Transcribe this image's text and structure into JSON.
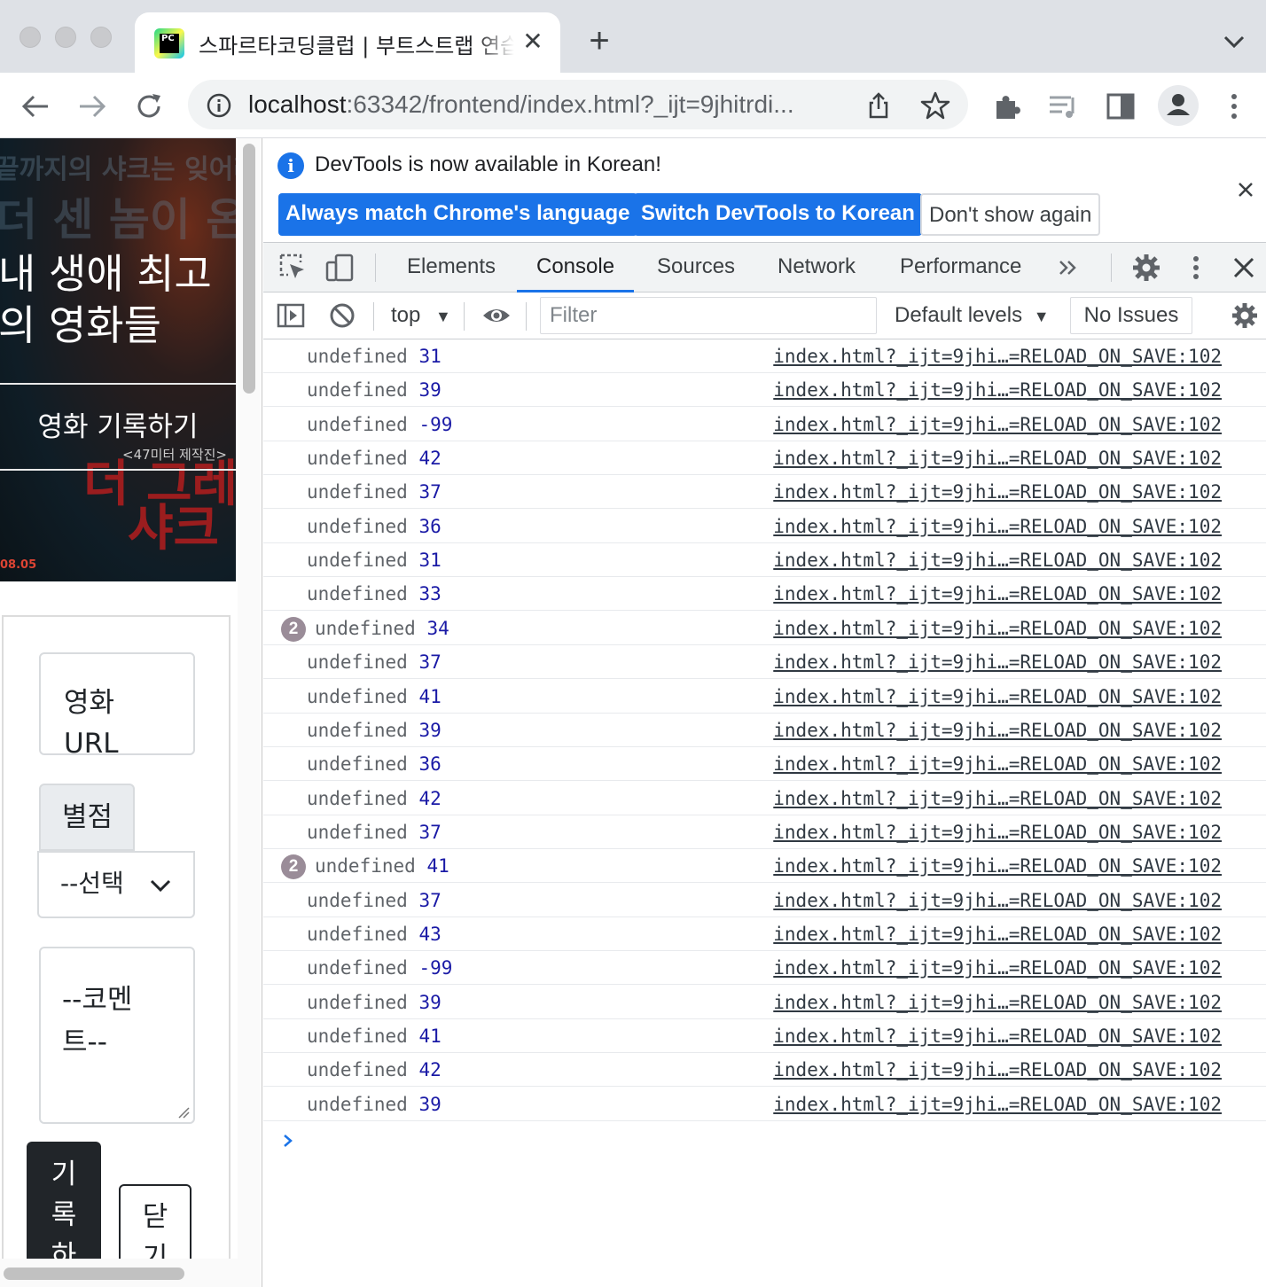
{
  "tab": {
    "favicon_text": "PC",
    "title": "스파르타코딩클럽 | 부트스트랩 연습하기"
  },
  "address": {
    "url_host": "localhost",
    "url_rest": ":63342/frontend/index.html?_ijt=9jhitrdi..."
  },
  "page": {
    "hero_bg_line1": "끝까지의 샤크는 잊어라",
    "hero_bg_line2": "더 센 놈이 온다",
    "hero_title_line1": "내 생애 최고",
    "hero_title_line2": "의 영화들",
    "hero_button": "영화 기록하기",
    "poster_subtitle": "<47미터 제작진>",
    "poster_title_line1": "더 그레이트",
    "poster_title_line2": "샤크",
    "poster_date": "08.05",
    "form": {
      "url_placeholder_line1": "영화",
      "url_placeholder_line2": "URL",
      "star_label": "별점",
      "star_select": "--선택",
      "comment_line1": "--코멘",
      "comment_line2": "트--",
      "submit_line1": "기",
      "submit_line2": "록",
      "submit_line3": "하",
      "close_line1": "닫",
      "close_line2": "기"
    }
  },
  "devtools": {
    "infobar": {
      "message": "DevTools is now available in Korean!",
      "btn_match": "Always match Chrome's language",
      "btn_switch": "Switch DevTools to Korean",
      "btn_dismiss": "Don't show again"
    },
    "tabs": [
      "Elements",
      "Console",
      "Sources",
      "Network",
      "Performance"
    ],
    "active_tab": "Console",
    "console_toolbar": {
      "context": "top",
      "filter_placeholder": "Filter",
      "levels": "Default levels",
      "issues": "No Issues"
    },
    "source_link": "index.html?_ijt=9jhi…=RELOAD_ON_SAVE:102",
    "logs": [
      {
        "text": "undefined",
        "value": "31",
        "count": null
      },
      {
        "text": "undefined",
        "value": "39",
        "count": null
      },
      {
        "text": "undefined",
        "value": "-99",
        "count": null
      },
      {
        "text": "undefined",
        "value": "42",
        "count": null
      },
      {
        "text": "undefined",
        "value": "37",
        "count": null
      },
      {
        "text": "undefined",
        "value": "36",
        "count": null
      },
      {
        "text": "undefined",
        "value": "31",
        "count": null
      },
      {
        "text": "undefined",
        "value": "33",
        "count": null
      },
      {
        "text": "undefined",
        "value": "34",
        "count": "2"
      },
      {
        "text": "undefined",
        "value": "37",
        "count": null
      },
      {
        "text": "undefined",
        "value": "41",
        "count": null
      },
      {
        "text": "undefined",
        "value": "39",
        "count": null
      },
      {
        "text": "undefined",
        "value": "36",
        "count": null
      },
      {
        "text": "undefined",
        "value": "42",
        "count": null
      },
      {
        "text": "undefined",
        "value": "37",
        "count": null
      },
      {
        "text": "undefined",
        "value": "41",
        "count": "2"
      },
      {
        "text": "undefined",
        "value": "37",
        "count": null
      },
      {
        "text": "undefined",
        "value": "43",
        "count": null
      },
      {
        "text": "undefined",
        "value": "-99",
        "count": null
      },
      {
        "text": "undefined",
        "value": "39",
        "count": null
      },
      {
        "text": "undefined",
        "value": "41",
        "count": null
      },
      {
        "text": "undefined",
        "value": "42",
        "count": null
      },
      {
        "text": "undefined",
        "value": "39",
        "count": null
      }
    ]
  },
  "colors": {
    "accent": "#1a73e8",
    "number": "#1a1aa6",
    "log_text": "#5f6368"
  }
}
